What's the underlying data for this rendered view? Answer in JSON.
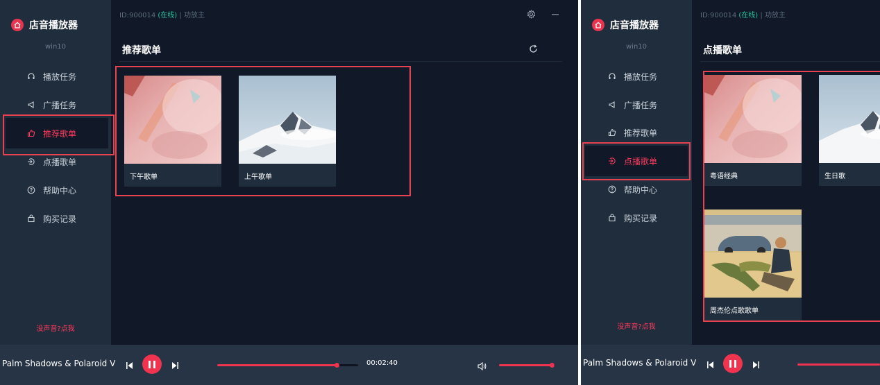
{
  "left": {
    "app_name": "店音播放器",
    "device": "win10",
    "top_info": {
      "id": "ID:900014",
      "status": "(在线)",
      "separator": "|",
      "role": "功放主"
    },
    "nav": [
      {
        "label": "播放任务",
        "icon": "headphones-icon"
      },
      {
        "label": "广播任务",
        "icon": "megaphone-icon"
      },
      {
        "label": "推荐歌单",
        "icon": "thumbs-up-icon",
        "active": true
      },
      {
        "label": "点播歌单",
        "icon": "login-icon"
      },
      {
        "label": "帮助中心",
        "icon": "help-icon"
      },
      {
        "label": "购买记录",
        "icon": "bag-icon"
      }
    ],
    "nosound": "没声音?点我",
    "section_title": "推荐歌单",
    "playlists": [
      {
        "label": "下午歌单",
        "cover": "pink-crystal"
      },
      {
        "label": "上午歌单",
        "cover": "snow-mountain"
      }
    ],
    "player": {
      "song": "Palm Shadows & Polaroid V",
      "time": "00:02:40",
      "progress": 0.85,
      "volume": 0.95
    }
  },
  "right": {
    "app_name": "店音播放器",
    "device": "win10",
    "top_info": {
      "id": "ID:900014",
      "status": "(在线)",
      "separator": "|",
      "role": "功放主"
    },
    "nav": [
      {
        "label": "播放任务",
        "icon": "headphones-icon"
      },
      {
        "label": "广播任务",
        "icon": "megaphone-icon"
      },
      {
        "label": "推荐歌单",
        "icon": "thumbs-up-icon"
      },
      {
        "label": "点播歌单",
        "icon": "login-icon",
        "active": true
      },
      {
        "label": "帮助中心",
        "icon": "help-icon"
      },
      {
        "label": "购买记录",
        "icon": "bag-icon"
      }
    ],
    "nosound": "没声音?点我",
    "section_title": "点播歌单",
    "playlists": [
      {
        "label": "粤语经典",
        "cover": "pink-crystal"
      },
      {
        "label": "生日歌",
        "cover": "snow-mountain"
      },
      {
        "label": "周杰伦点歌歌单",
        "cover": "street-illustration"
      }
    ],
    "player": {
      "song": "Palm Shadows & Polaroid V"
    }
  },
  "colors": {
    "accent": "#f0344f",
    "sidebar": "#1f2d3d",
    "main": "#111827",
    "player": "#263446",
    "highlight": "#e8414f",
    "online": "#28c8a0"
  }
}
